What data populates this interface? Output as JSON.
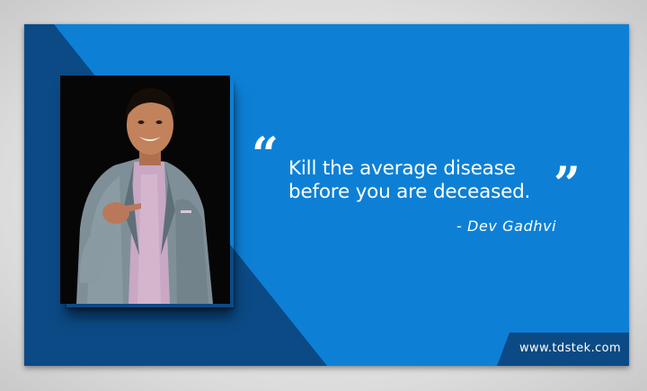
{
  "quote": {
    "open_mark": "“",
    "close_mark": "”",
    "line1": "Kill the average disease",
    "line2": "before you are deceased."
  },
  "author": "- Dev Gadhvi",
  "website": "www.tdstek.com",
  "colors": {
    "primary_blue": "#0d80d6",
    "dark_blue": "#0b4a85",
    "text": "#ffffff"
  }
}
